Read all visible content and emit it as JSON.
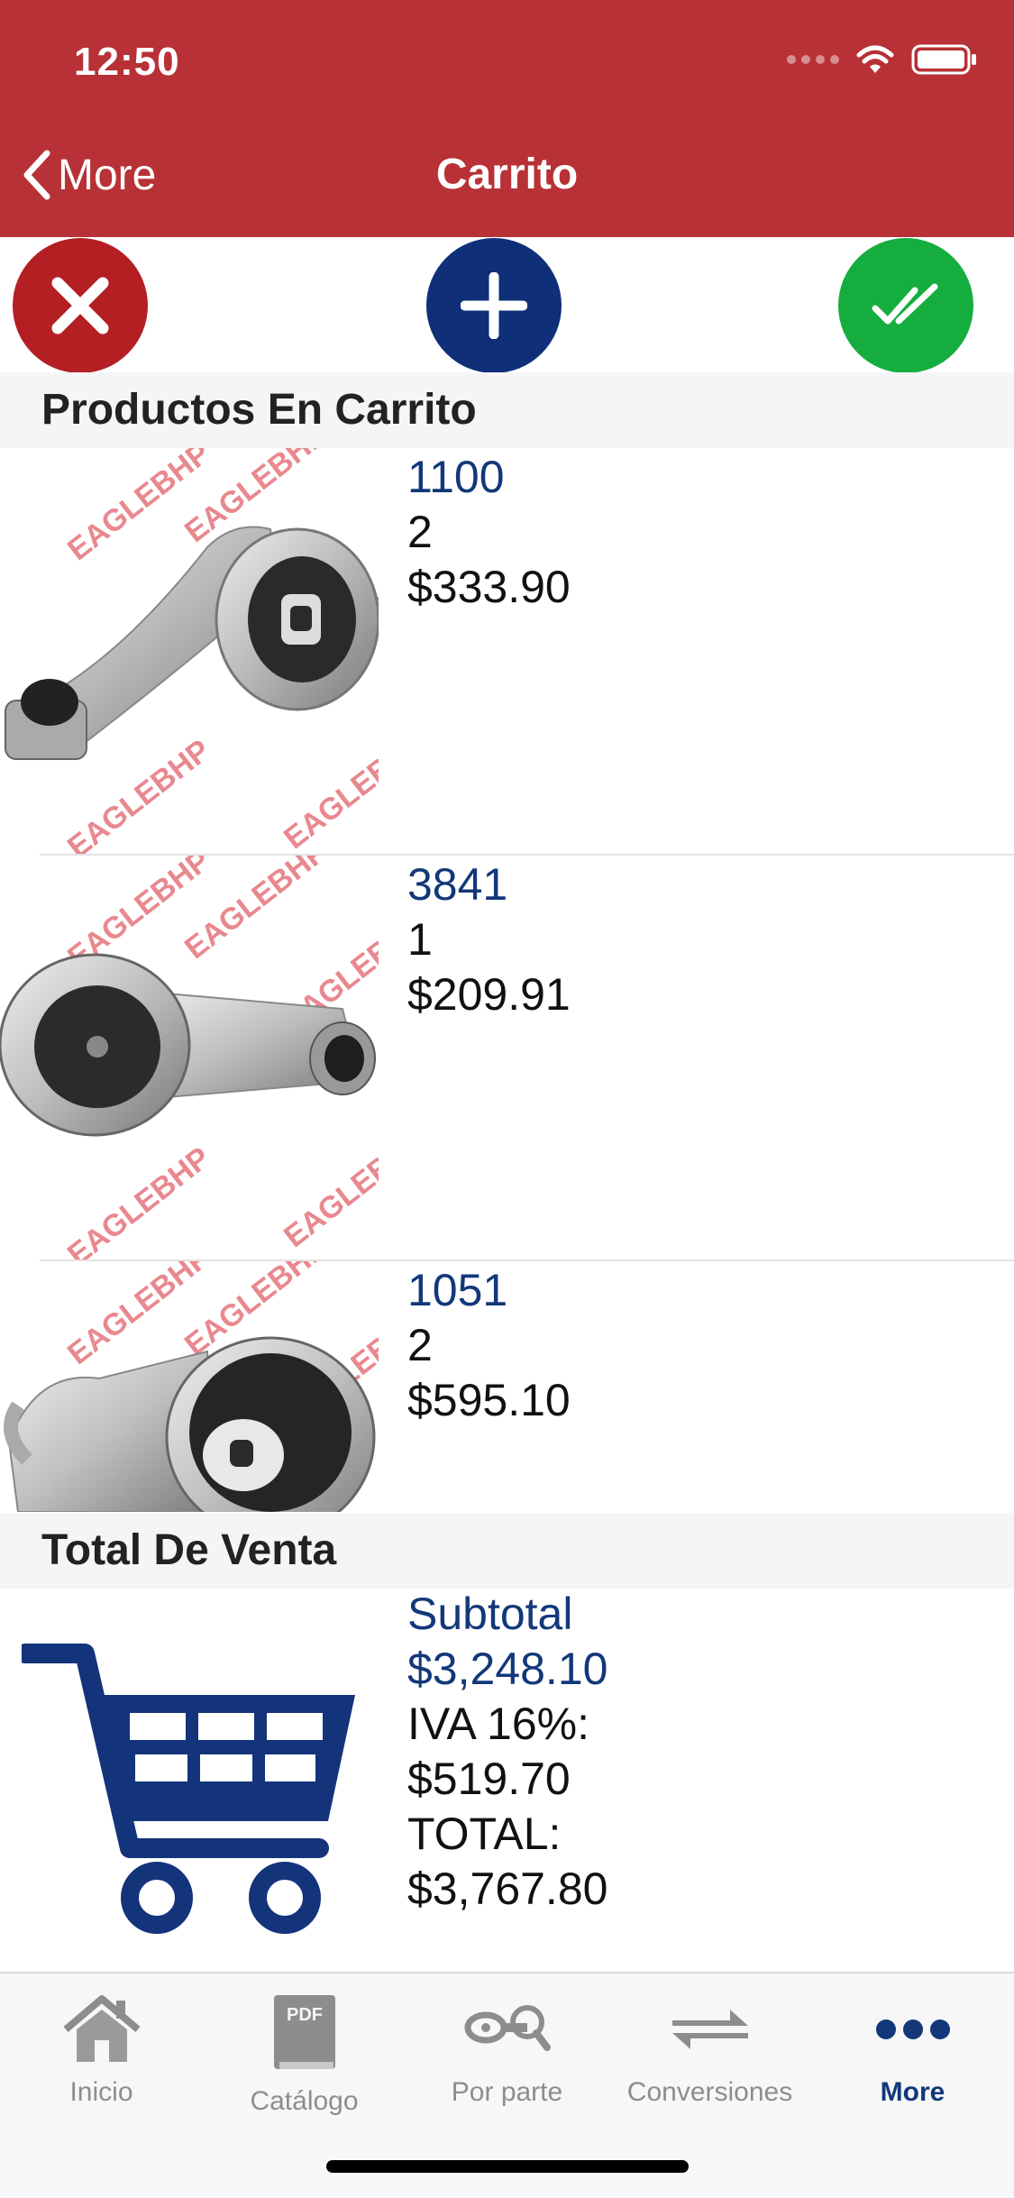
{
  "status_bar": {
    "time": "12:50"
  },
  "nav": {
    "back_label": "More",
    "title": "Carrito"
  },
  "actions": {
    "cancel_icon": "close-icon",
    "add_icon": "plus-icon",
    "confirm_icon": "double-check-icon"
  },
  "sections": {
    "products": "Productos En Carrito",
    "totals": "Total De Venta"
  },
  "products": [
    {
      "code": "1100",
      "qty": "2",
      "price": "$333.90"
    },
    {
      "code": "3841",
      "qty": "1",
      "price": "$209.91"
    },
    {
      "code": "1051",
      "qty": "2",
      "price": "$595.10"
    }
  ],
  "watermark": "EAGLEBHP",
  "totals": {
    "subtotal_label": "Subtotal",
    "subtotal_value": "$3,248.10",
    "iva_label": "IVA 16%:",
    "iva_value": "$519.70",
    "total_label": "TOTAL:",
    "total_value": "$3,767.80"
  },
  "tabs": [
    {
      "label": "Inicio",
      "icon": "home-icon"
    },
    {
      "label": "Catálogo",
      "icon": "pdf-book-icon"
    },
    {
      "label": "Por parte",
      "icon": "parts-icon"
    },
    {
      "label": "Conversiones",
      "icon": "conversions-icon"
    },
    {
      "label": "More",
      "icon": "more-icon"
    }
  ],
  "colors": {
    "header": "#b83136",
    "primary_blue": "#12387a",
    "cancel_red": "#b41f24",
    "confirm_green": "#16ad3f"
  }
}
